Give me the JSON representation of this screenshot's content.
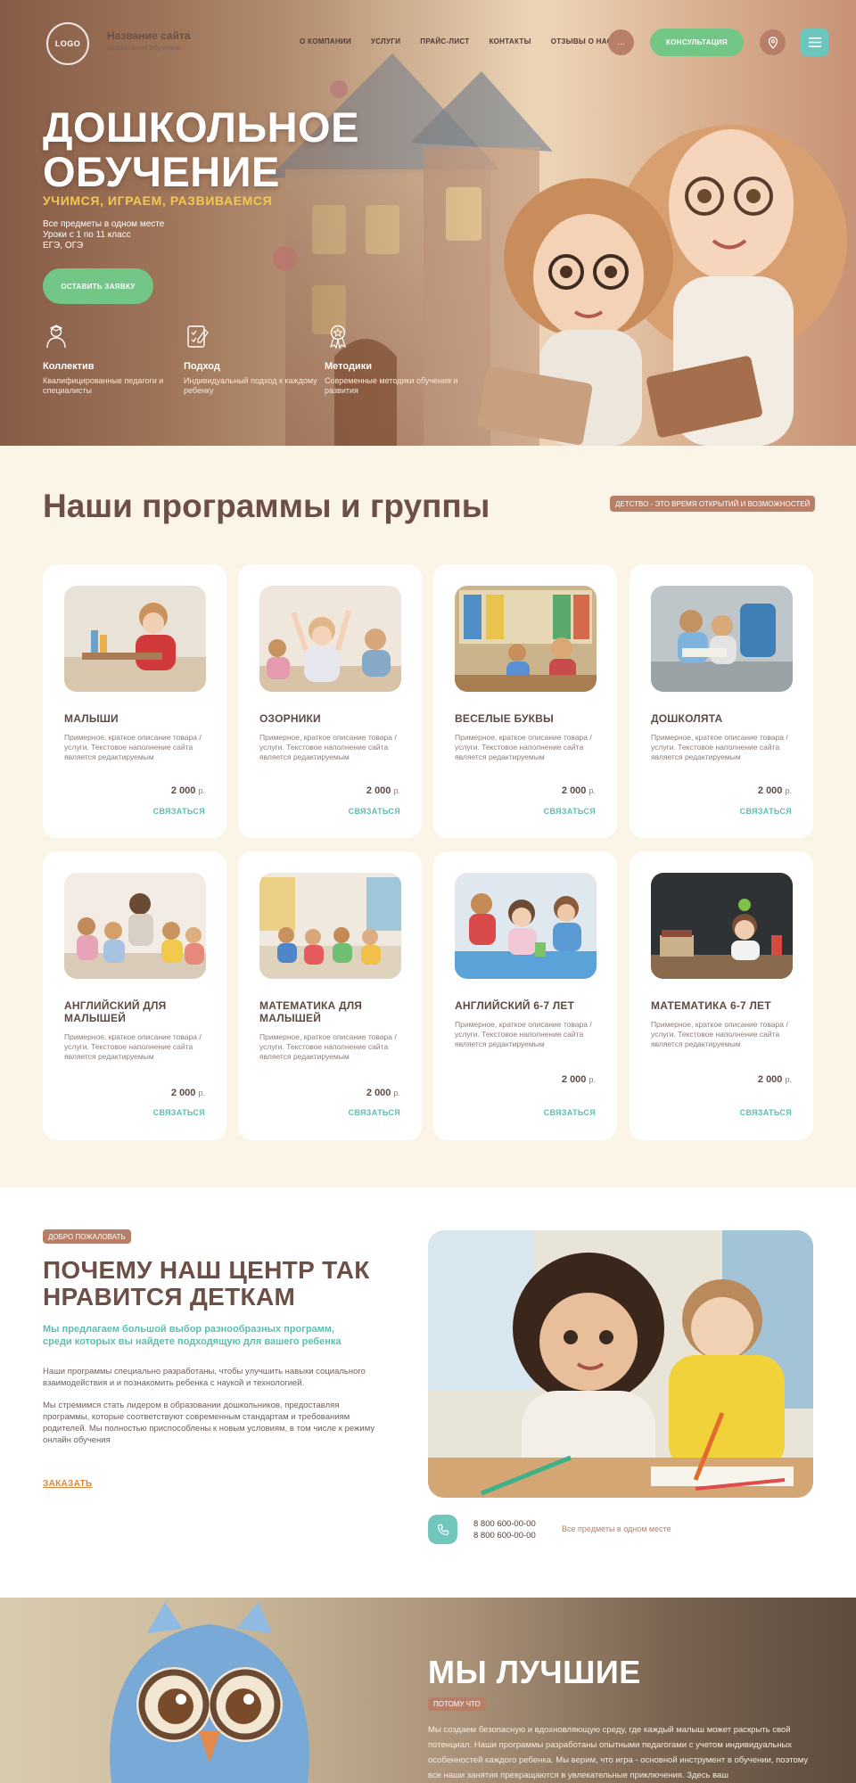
{
  "header": {
    "logo_text": "LOGO",
    "site_name": "Название сайта",
    "site_subtitle": "дошкольное обучение",
    "nav": [
      "О КОМПАНИИ",
      "УСЛУГИ",
      "ПРАЙС-ЛИСТ",
      "КОНТАКТЫ",
      "ОТЗЫВЫ О НАС"
    ],
    "dots_label": "...",
    "consult_label": "КОНСУЛЬТАЦИЯ",
    "icons": [
      "map-pin-icon",
      "menu-icon"
    ]
  },
  "hero": {
    "title": "ДОШКОЛЬНОЕ ОБУЧЕНИЕ",
    "tagline": "УЧИМСЯ, ИГРАЕМ, РАЗВИВАЕМСЯ",
    "info_lines": [
      "Все предметы в одном месте",
      "Уроки с 1 по 11 класс",
      "ЕГЭ, ОГЭ"
    ],
    "cta_label": "ОСТАВИТЬ ЗАЯВКУ",
    "features": [
      {
        "icon": "teacher-icon",
        "title": "Коллектив",
        "desc": "Квалифицированные педагоги и специалисты"
      },
      {
        "icon": "checklist-icon",
        "title": "Подход",
        "desc": "Индивидуальный подход к каждому ребенку"
      },
      {
        "icon": "award-icon",
        "title": "Методики",
        "desc": "Современные методики обучения и развития"
      }
    ]
  },
  "programs": {
    "title": "Наши программы и группы",
    "badge": "ДЕТСТВО - ЭТО ВРЕМЯ ОТКРЫТИЙ И ВОЗМОЖНОСТЕЙ",
    "cards": [
      {
        "title": "МАЛЫШИ",
        "desc": "Примерное, краткое описание товара / услуги. Текстовое наполнение сайта является редактируемым",
        "price": "2 000",
        "currency": "р.",
        "action": "СВЯЗАТЬСЯ"
      },
      {
        "title": "ОЗОРНИКИ",
        "desc": "Примерное, краткое описание товара / услуги. Текстовое наполнение сайта является редактируемым",
        "price": "2 000",
        "currency": "р.",
        "action": "СВЯЗАТЬСЯ"
      },
      {
        "title": "ВЕСЕЛЫЕ БУКВЫ",
        "desc": "Примерное, краткое описание товара / услуги. Текстовое наполнение сайта является редактируемым",
        "price": "2 000",
        "currency": "р.",
        "action": "СВЯЗАТЬСЯ"
      },
      {
        "title": "ДОШКОЛЯТА",
        "desc": "Примерное, краткое описание товара / услуги. Текстовое наполнение сайта является редактируемым",
        "price": "2 000",
        "currency": "р.",
        "action": "СВЯЗАТЬСЯ"
      },
      {
        "title": "АНГЛИЙСКИЙ ДЛЯ МАЛЫШЕЙ",
        "desc": "Примерное, краткое описание товара / услуги. Текстовое наполнение сайта является редактируемым",
        "price": "2 000",
        "currency": "р.",
        "action": "СВЯЗАТЬСЯ"
      },
      {
        "title": "МАТЕМАТИКА ДЛЯ МАЛЫШЕЙ",
        "desc": "Примерное, краткое описание товара / услуги. Текстовое наполнение сайта является редактируемым",
        "price": "2 000",
        "currency": "р.",
        "action": "СВЯЗАТЬСЯ"
      },
      {
        "title": "АНГЛИЙСКИЙ 6-7 ЛЕТ",
        "desc": "Примерное, краткое описание товара / услуги. Текстовое наполнение сайта является редактируемым",
        "price": "2 000",
        "currency": "р.",
        "action": "СВЯЗАТЬСЯ"
      },
      {
        "title": "МАТЕМАТИКА 6-7 ЛЕТ",
        "desc": "Примерное, краткое описание товара / услуги. Текстовое наполнение сайта является редактируемым",
        "price": "2 000",
        "currency": "р.",
        "action": "СВЯЗАТЬСЯ"
      }
    ]
  },
  "why": {
    "badge": "ДОБРО ПОЖАЛОВАТЬ",
    "title": "ПОЧЕМУ НАШ ЦЕНТР ТАК НРАВИТСЯ ДЕТКАМ",
    "subtitle": "Мы предлагаем большой выбор разнообразных программ, среди которых вы найдете подходящую для вашего ребенка",
    "p1": "Наши программы специально разработаны, чтобы улучшить навыки социального взаимодействия и и познакомить ребенка с наукой и технологией.",
    "p2": "Мы стремимся стать лидером в образовании дошкольников, предоставляя программы, которые соответствуют современным стандартам и требованиям родителей. Мы полностью приспособлены к новым условиям, в том числе к режиму онлайн обучения",
    "order_label": "ЗАКАЗАТЬ",
    "phones": [
      "8 800 600-00-00",
      "8 800 600-00-00"
    ],
    "all_subjects": "Все предметы в одном месте"
  },
  "best": {
    "title": "МЫ ЛУЧШИЕ",
    "badge": "ПОТОМУ ЧТО",
    "text": "Мы создаем безопасную и вдохновляющую среду, где каждый малыш может раскрыть свой потенциал. Наши программы разработаны опытными педагогами с учетом индивидуальных особенностей каждого ребенка. Мы верим, что игра - основной инструмент в обучении, поэтому все наши занятия превращаются в увлекательные приключения. Здесь ваш"
  },
  "colors": {
    "brown": "#b77f68",
    "heading_brown": "#6d4f45",
    "green": "#72c786",
    "teal": "#5bbfb0",
    "yellow": "#f3c84c",
    "orange_link": "#e0883a",
    "cream_bg": "#fbf5e7"
  }
}
